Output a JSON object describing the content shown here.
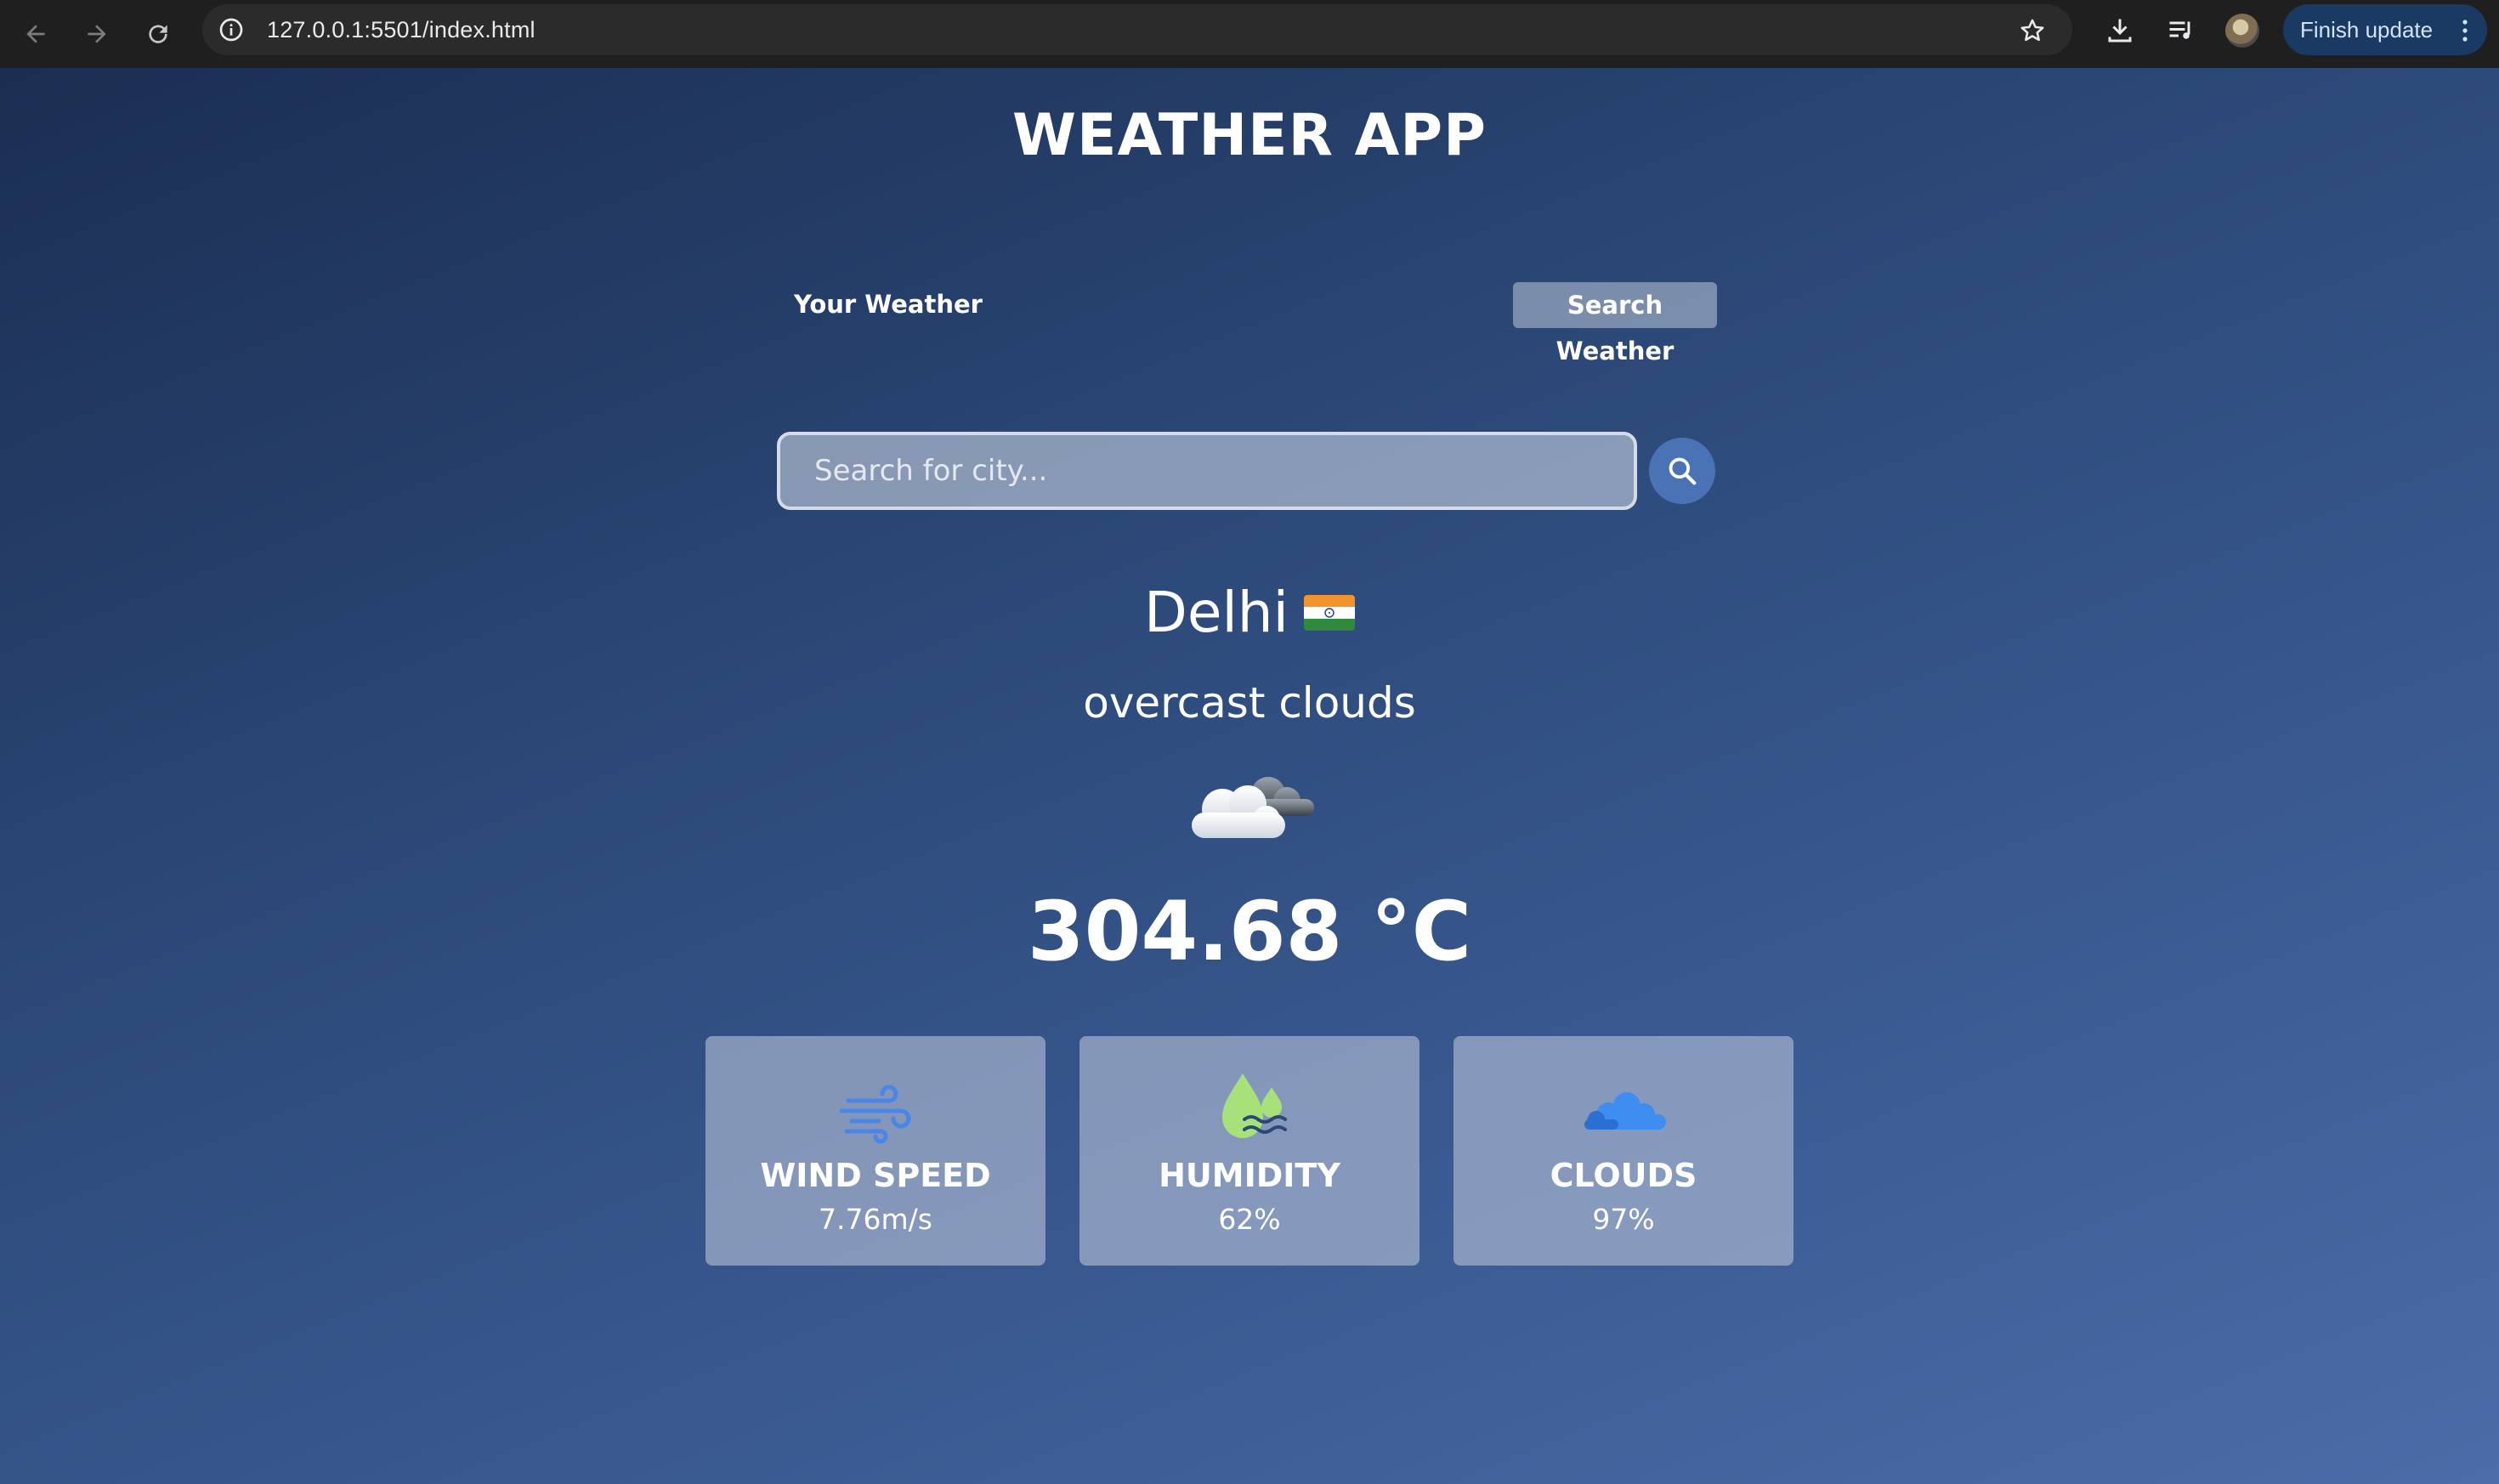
{
  "browser": {
    "url": "127.0.0.1:5501/index.html",
    "update_button_label": "Finish update"
  },
  "app": {
    "title": "WEATHER APP",
    "tabs": {
      "your_weather": "Your Weather",
      "search_weather": "Search Weather"
    },
    "search": {
      "placeholder": "Search for city...",
      "value": ""
    },
    "weather": {
      "city": "Delhi",
      "description": "overcast clouds",
      "temperature": "304.68 °C"
    },
    "stats": [
      {
        "label": "WIND SPEED",
        "value": "7.76m/s",
        "icon": "wind-icon"
      },
      {
        "label": "HUMIDITY",
        "value": "62%",
        "icon": "humidity-icon"
      },
      {
        "label": "CLOUDS",
        "value": "97%",
        "icon": "clouds-icon"
      }
    ]
  },
  "colors": {
    "background_top": "#1b2e52",
    "background_bottom": "#4b6ca8",
    "search_button": "#4a73b6",
    "humidity_icon": "#a8e07a",
    "wind_icon": "#4a86e8",
    "clouds_icon": "#3d8ef0"
  }
}
